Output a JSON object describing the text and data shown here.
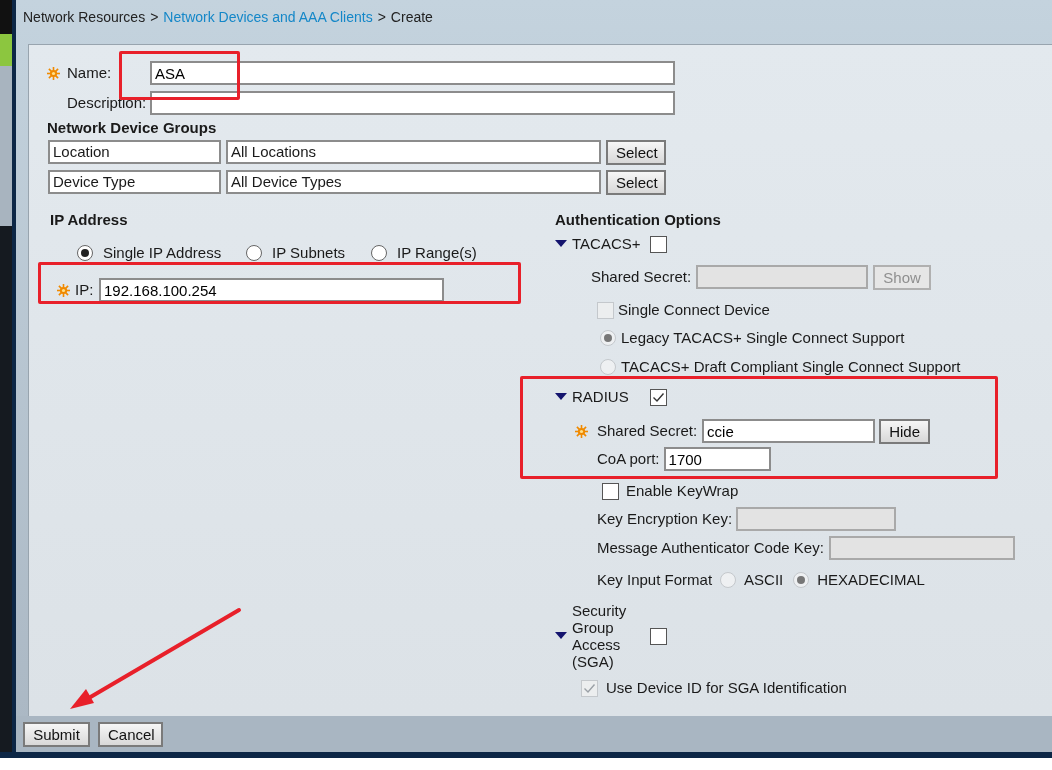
{
  "breadcrumb": [
    {
      "label": "Network Resources",
      "link": false,
      "separator": ">"
    },
    {
      "label": "Network Devices and AAA Clients",
      "link": true,
      "separator": ">"
    },
    {
      "label": "Create",
      "link": false
    }
  ],
  "name": {
    "label": "Name:",
    "value": "ASA",
    "required": true,
    "highlighted": true
  },
  "description": {
    "label": "Description:"
  },
  "device_groups": {
    "title": "Network Device Groups",
    "rows": [
      {
        "group": "Location",
        "value": "All Locations",
        "button": "Select"
      },
      {
        "group": "Device Type",
        "value": "All Device Types",
        "button": "Select"
      }
    ]
  },
  "ip_address": {
    "title": "IP Address",
    "highlighted": true,
    "options": [
      {
        "label": "Single IP Address",
        "selected": true
      },
      {
        "label": "IP Subnets",
        "selected": false
      },
      {
        "label": "IP Range(s)",
        "selected": false
      }
    ],
    "ip": {
      "label": "IP:",
      "value": "192.168.100.254",
      "required": true
    }
  },
  "authentication": {
    "title": "Authentication Options",
    "tacacs": {
      "label": "TACACS+",
      "expanded": true,
      "checked": false,
      "shared_secret": {
        "label": "Shared Secret:",
        "button": "Show",
        "disabled": true
      },
      "single_connect": {
        "label": "Single Connect Device",
        "checked": false,
        "disabled": true
      },
      "modes": [
        {
          "label": "Legacy TACACS+ Single Connect Support",
          "selected": true,
          "disabled": true
        },
        {
          "label": "TACACS+ Draft Compliant Single Connect Support",
          "selected": false,
          "disabled": true
        }
      ]
    },
    "radius": {
      "label": "RADIUS",
      "expanded": true,
      "checked": true,
      "highlighted": true,
      "shared_secret": {
        "label": "Shared Secret:",
        "value": "ccie",
        "button": "Hide",
        "required": true
      },
      "coa_port": {
        "label": "CoA port:",
        "value": "1700"
      },
      "keywrap": {
        "label": "Enable KeyWrap",
        "checked": false
      },
      "key_encryption_key": {
        "label": "Key Encryption Key:",
        "disabled": true
      },
      "mac_key": {
        "label": "Message Authenticator Code Key:",
        "disabled": true
      },
      "key_input_format": {
        "label": "Key Input Format",
        "options": [
          {
            "label": "ASCII",
            "selected": false
          },
          {
            "label": "HEXADECIMAL",
            "selected": true
          }
        ]
      }
    },
    "sga": {
      "label": "Security Group Access (SGA)",
      "expanded": true,
      "checked": false,
      "use_device_id": {
        "label": "Use Device ID for SGA Identification",
        "checked": true,
        "disabled": true
      }
    }
  },
  "buttons": [
    {
      "label": "Submit",
      "highlighted": true
    },
    {
      "label": "Cancel",
      "highlighted": false
    }
  ]
}
